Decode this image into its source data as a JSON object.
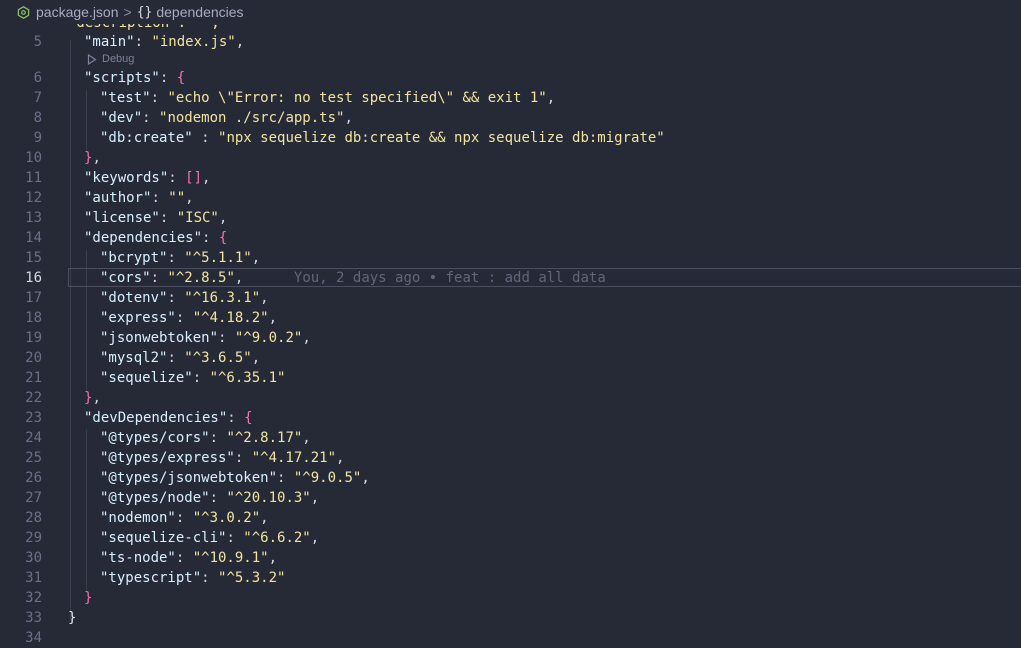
{
  "breadcrumb": {
    "file": "package.json",
    "separator": ">",
    "braces": "{}",
    "symbol": "dependencies"
  },
  "codelens": {
    "label": "Debug"
  },
  "partial_line_text": "\"description\": \"\",",
  "blame": "You, 2 days ago • feat : add all data",
  "lines": [
    {
      "n": "5",
      "key": "\"main\"",
      "value": "\"index.js\"",
      "trail": ","
    },
    {
      "n": "6",
      "key": "\"scripts\"",
      "open": "{"
    },
    {
      "n": "7",
      "key": "\"test\"",
      "value": "\"echo \\\"Error: no test specified\\\" && exit 1\"",
      "trail": ","
    },
    {
      "n": "8",
      "key": "\"dev\"",
      "value": "\"nodemon ./src/app.ts\"",
      "trail": ","
    },
    {
      "n": "9",
      "key": "\"db:create\"",
      "sep": " : ",
      "value": "\"npx sequelize db:create && npx sequelize db:migrate\""
    },
    {
      "n": "10",
      "close": "}",
      "trail": ","
    },
    {
      "n": "11",
      "key": "\"keywords\"",
      "value": "[]",
      "trail": ","
    },
    {
      "n": "12",
      "key": "\"author\"",
      "value": "\"\"",
      "trail": ","
    },
    {
      "n": "13",
      "key": "\"license\"",
      "value": "\"ISC\"",
      "trail": ","
    },
    {
      "n": "14",
      "key": "\"dependencies\"",
      "open": "{"
    },
    {
      "n": "15",
      "key": "\"bcrypt\"",
      "value": "\"^5.1.1\"",
      "trail": ","
    },
    {
      "n": "16",
      "key": "\"cors\"",
      "value": "\"^2.8.5\"",
      "trail": ","
    },
    {
      "n": "17",
      "key": "\"dotenv\"",
      "value": "\"^16.3.1\"",
      "trail": ","
    },
    {
      "n": "18",
      "key": "\"express\"",
      "value": "\"^4.18.2\"",
      "trail": ","
    },
    {
      "n": "19",
      "key": "\"jsonwebtoken\"",
      "value": "\"^9.0.2\"",
      "trail": ","
    },
    {
      "n": "20",
      "key": "\"mysql2\"",
      "value": "\"^3.6.5\"",
      "trail": ","
    },
    {
      "n": "21",
      "key": "\"sequelize\"",
      "value": "\"^6.35.1\""
    },
    {
      "n": "22",
      "close": "}",
      "trail": ","
    },
    {
      "n": "23",
      "key": "\"devDependencies\"",
      "open": "{"
    },
    {
      "n": "24",
      "key": "\"@types/cors\"",
      "value": "\"^2.8.17\"",
      "trail": ","
    },
    {
      "n": "25",
      "key": "\"@types/express\"",
      "value": "\"^4.17.21\"",
      "trail": ","
    },
    {
      "n": "26",
      "key": "\"@types/jsonwebtoken\"",
      "value": "\"^9.0.5\"",
      "trail": ","
    },
    {
      "n": "27",
      "key": "\"@types/node\"",
      "value": "\"^20.10.3\"",
      "trail": ","
    },
    {
      "n": "28",
      "key": "\"nodemon\"",
      "value": "\"^3.0.2\"",
      "trail": ","
    },
    {
      "n": "29",
      "key": "\"sequelize-cli\"",
      "value": "\"^6.6.2\"",
      "trail": ","
    },
    {
      "n": "30",
      "key": "\"ts-node\"",
      "value": "\"^10.9.1\"",
      "trail": ","
    },
    {
      "n": "31",
      "key": "\"typescript\"",
      "value": "\"^5.3.2\""
    },
    {
      "n": "32",
      "close": "}"
    },
    {
      "n": "33",
      "close": "}"
    },
    {
      "n": "34"
    }
  ],
  "colors": {
    "background": "#262936",
    "key": "#d7f0ff",
    "string": "#f1e4a0",
    "bracket": "#f472b6",
    "line_number": "#6c7086",
    "blame": "#62667a"
  }
}
